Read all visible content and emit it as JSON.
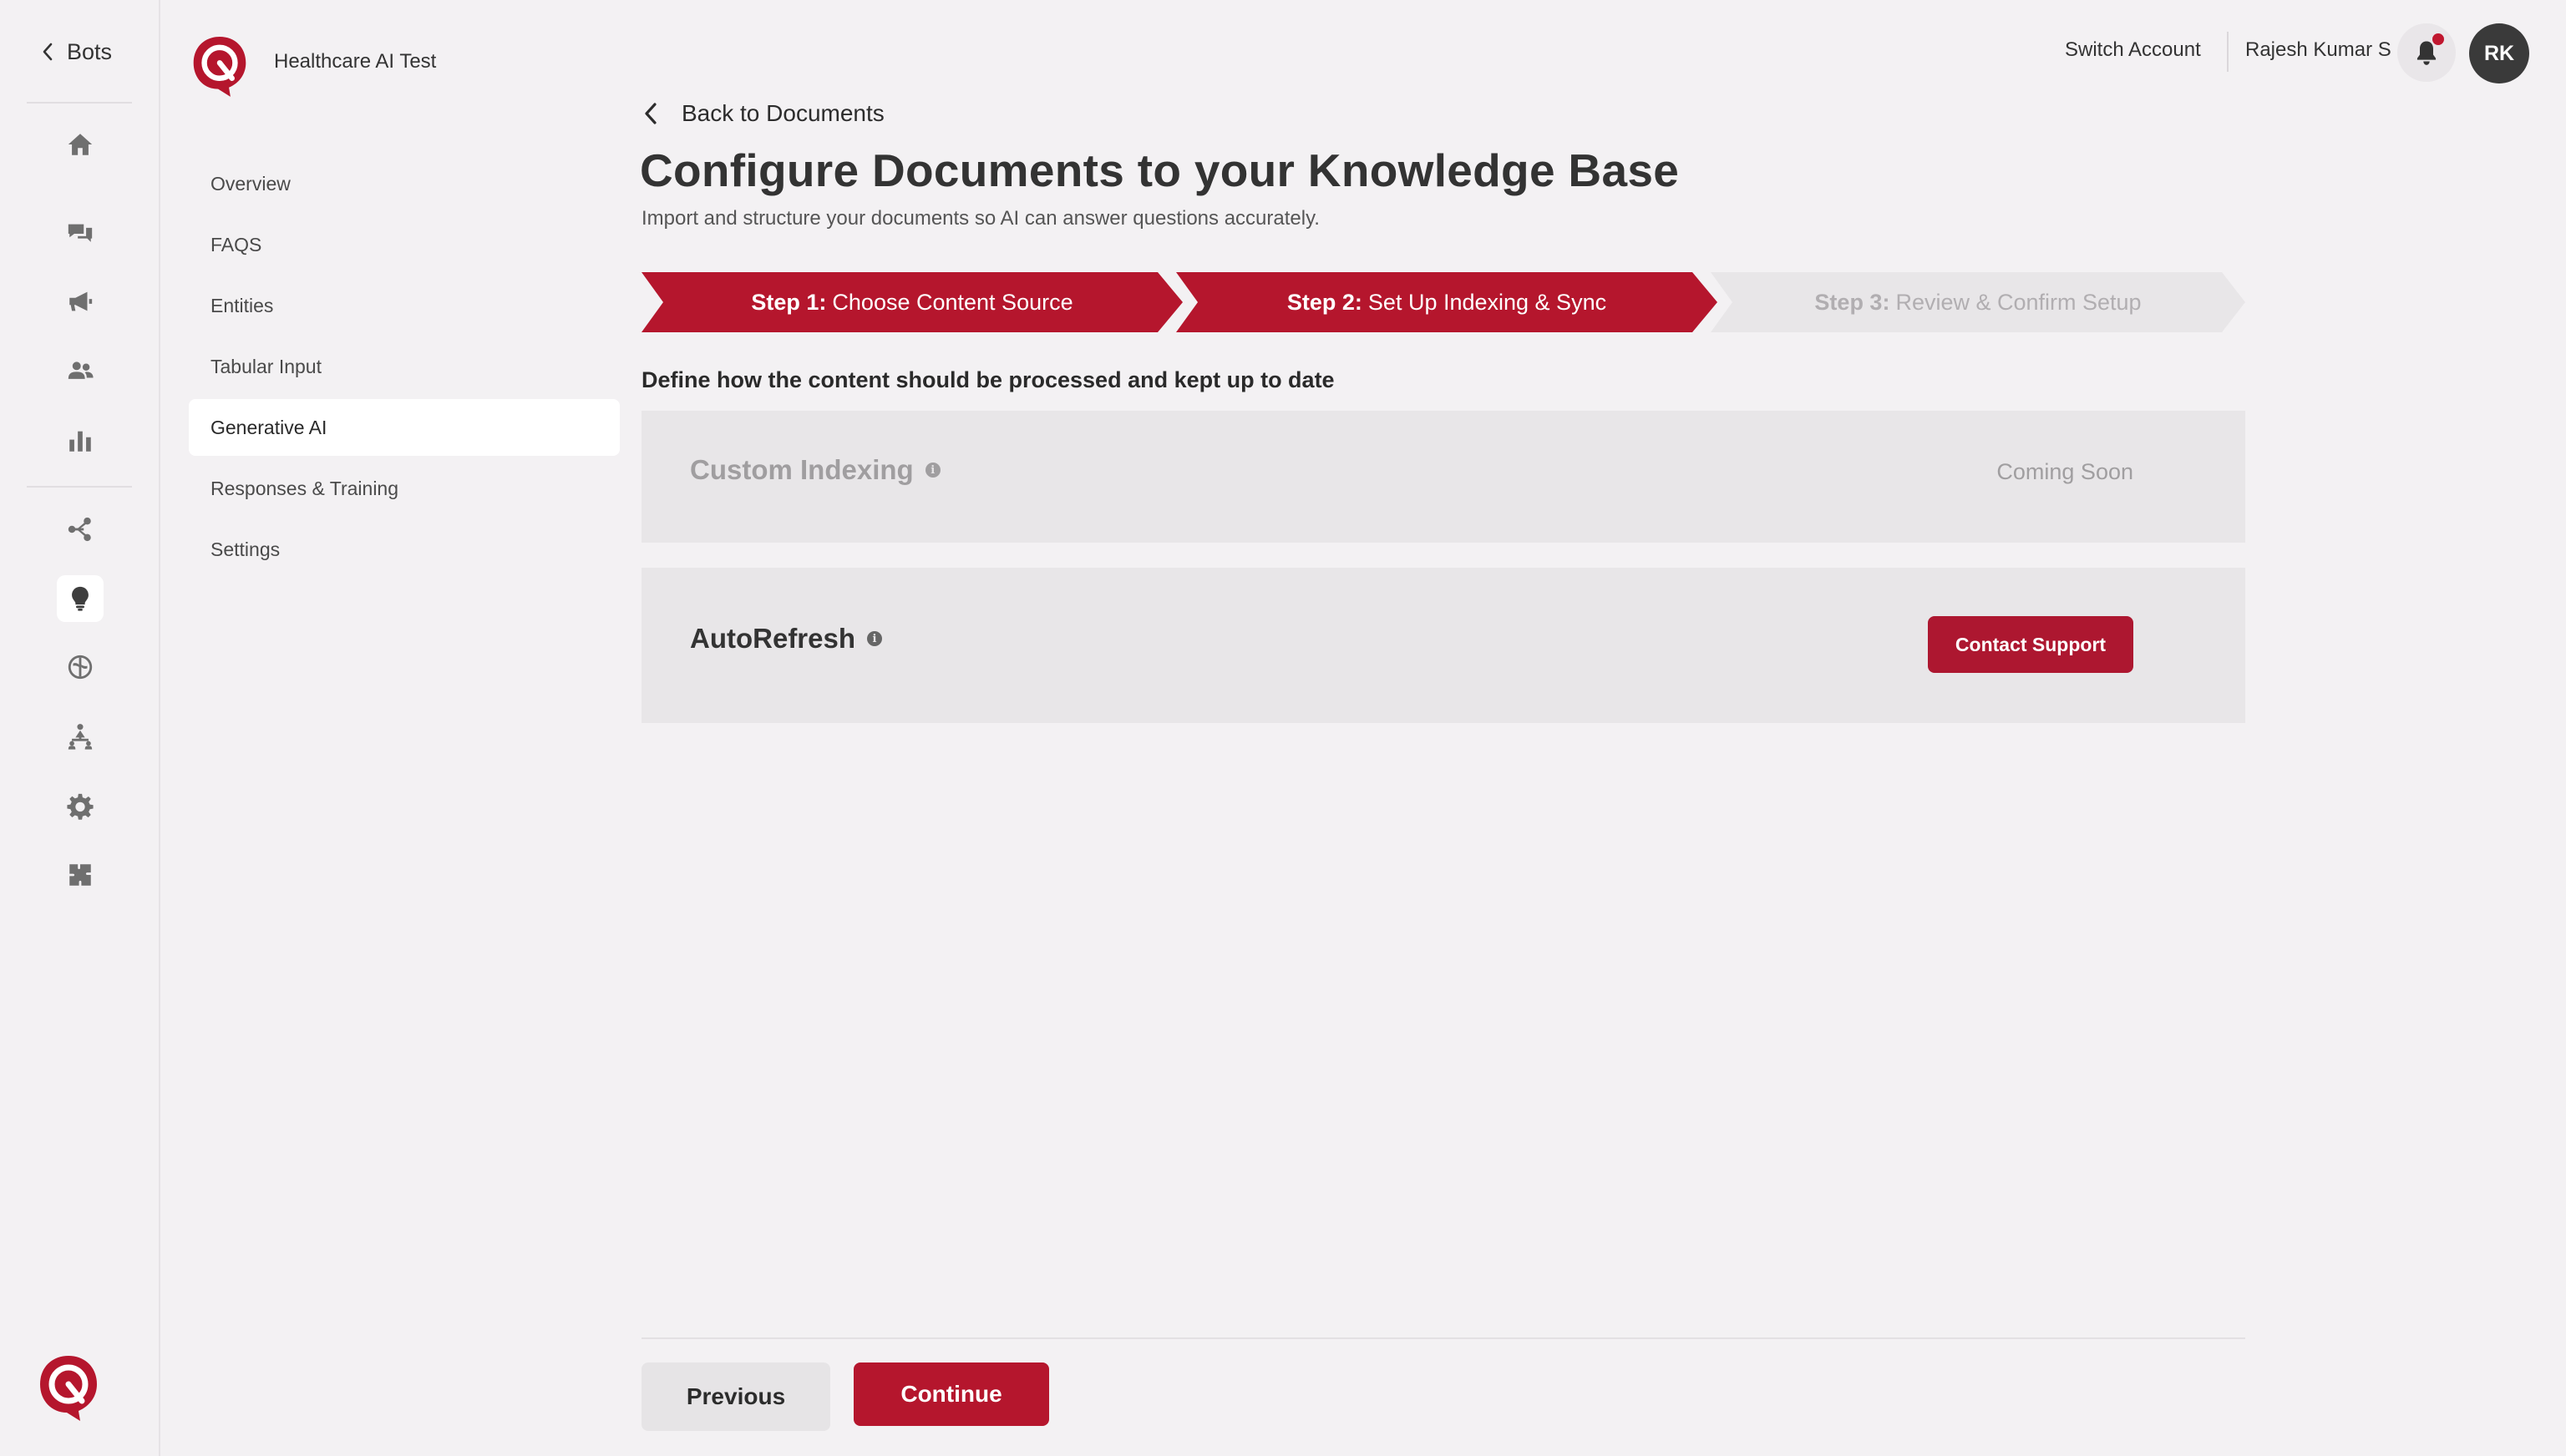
{
  "colors": {
    "accent": "#b5162d",
    "background": "#f3f1f3",
    "card": "#e8e6e8",
    "muted_text": "#a09ea0"
  },
  "rail": {
    "back_label": "Bots",
    "icons": [
      {
        "name": "home-icon"
      },
      {
        "name": "chat-icon"
      },
      {
        "name": "megaphone-icon"
      },
      {
        "name": "users-icon"
      },
      {
        "name": "bar-chart-icon"
      },
      {
        "name": "flow-icon"
      },
      {
        "name": "lightbulb-icon",
        "active": true
      },
      {
        "name": "brain-icon"
      },
      {
        "name": "hierarchy-icon"
      },
      {
        "name": "gear-icon"
      },
      {
        "name": "puzzle-icon"
      }
    ]
  },
  "subnav": {
    "bot_name": "Healthcare AI Test",
    "items": [
      {
        "label": "Overview"
      },
      {
        "label": "FAQS"
      },
      {
        "label": "Entities"
      },
      {
        "label": "Tabular Input"
      },
      {
        "label": "Generative AI",
        "active": true
      },
      {
        "label": "Responses & Training"
      },
      {
        "label": "Settings"
      }
    ]
  },
  "topbar": {
    "switch_account": "Switch Account",
    "user_name": "Rajesh Kumar S",
    "avatar_initials": "RK",
    "has_notification": true
  },
  "main": {
    "back_label": "Back to Documents",
    "title": "Configure Documents to your Knowledge Base",
    "subtitle": "Import and structure your documents so AI can answer questions accurately.",
    "steps": [
      {
        "label": "Step 1:",
        "text": "Choose Content Source",
        "state": "complete"
      },
      {
        "label": "Step 2:",
        "text": "Set Up Indexing & Sync",
        "state": "current"
      },
      {
        "label": "Step 3:",
        "text": "Review & Confirm Setup",
        "state": "upcoming"
      }
    ],
    "section_heading": "Define how the content should be processed and kept up to date",
    "custom_indexing": {
      "title": "Custom Indexing",
      "status": "Coming Soon"
    },
    "autorefresh": {
      "title": "AutoRefresh",
      "button": "Contact Support"
    }
  },
  "footer": {
    "previous_label": "Previous",
    "continue_label": "Continue"
  }
}
